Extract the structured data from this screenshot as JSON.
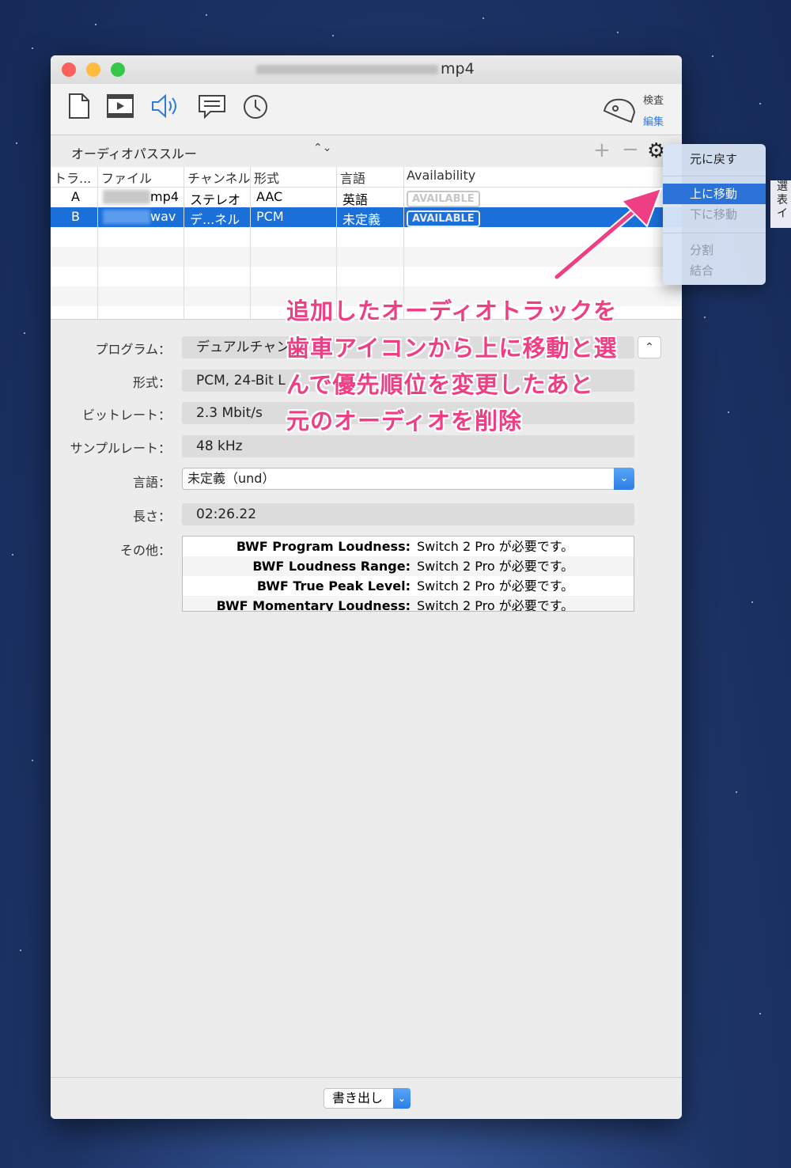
{
  "window": {
    "title_suffix": "mp4"
  },
  "toolbar": {
    "icons": [
      "document-icon",
      "movie-icon",
      "speaker-icon",
      "comment-icon",
      "clock-icon"
    ],
    "inspect_label": "検査",
    "edit_label": "編集"
  },
  "trackbar": {
    "mode": "オーディオパススルー",
    "add": "+",
    "remove": "−"
  },
  "table": {
    "headers": [
      "トラ...",
      "ファイル",
      "チャンネル",
      "形式",
      "言語",
      "Availability"
    ],
    "rows": [
      {
        "track": "A",
        "file": "mp4",
        "channel": "ステレオ",
        "format": "AAC",
        "language": "英語",
        "availability": "AVAILABLE",
        "selected": false
      },
      {
        "track": "B",
        "file": "wav",
        "channel": "デ...ネル",
        "format": "PCM",
        "language": "未定義",
        "availability": "AVAILABLE",
        "selected": true
      }
    ]
  },
  "details": {
    "program_label": "プログラム：",
    "program_value": "デュアルチャン",
    "format_label": "形式：",
    "format_value": "PCM, 24-Bit L",
    "bitrate_label": "ビットレート：",
    "bitrate_value": "2.3 Mbit/s",
    "samplerate_label": "サンプルレート：",
    "samplerate_value": "48 kHz",
    "language_label": "言語：",
    "language_value": "未定義（und）",
    "length_label": "長さ：",
    "length_value": "02:26.22",
    "other_label": "その他：",
    "other_rows": [
      {
        "key": "BWF Program Loudness:",
        "value": "Switch 2 Pro が必要です。"
      },
      {
        "key": "BWF Loudness Range:",
        "value": "Switch 2 Pro が必要です。"
      },
      {
        "key": "BWF True Peak Level:",
        "value": "Switch 2 Pro が必要です。"
      },
      {
        "key": "BWF Momentary Loudness:",
        "value": "Switch 2 Pro が必要です。"
      }
    ]
  },
  "export": {
    "label": "書き出し"
  },
  "context_menu": {
    "undo": "元に戻す",
    "move_up": "上に移動",
    "move_down": "下に移動",
    "split": "分割",
    "merge": "結合"
  },
  "edge_panel": {
    "lines": [
      "選",
      "表",
      "イ"
    ]
  },
  "annotation": {
    "lines": [
      "追加したオーディオトラックを",
      "歯車アイコンから上に移動と選",
      "んで優先順位を変更したあと",
      "元のオーディオを削除"
    ],
    "color": "#ef3f84"
  },
  "colors": {
    "selection": "#1a6fd9",
    "accent": "#2f7bd8",
    "close": "#fc605c",
    "minimize": "#fdbc40",
    "zoom": "#34c84a"
  }
}
